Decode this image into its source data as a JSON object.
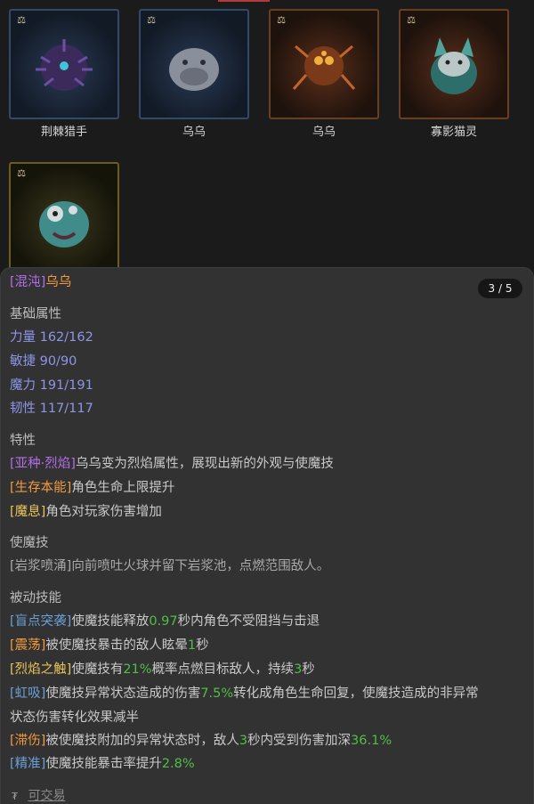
{
  "cards": [
    {
      "name": "荆棘猎手",
      "frame": "blue",
      "icon": "thorny-beast-icon"
    },
    {
      "name": "乌乌",
      "frame": "blue",
      "icon": "pale-beast-icon"
    },
    {
      "name": "乌乌",
      "frame": "orange",
      "icon": "fire-spider-icon"
    },
    {
      "name": "寡影猫灵",
      "frame": "orange",
      "icon": "ghost-cat-icon"
    },
    {
      "name": "",
      "frame": "gold",
      "icon": "teal-beast-icon"
    }
  ],
  "rank_glyph": "⚖",
  "detail": {
    "title_prefix": "[混沌]",
    "title_name": "乌乌",
    "pager": "3 / 5",
    "base_heading": "基础属性",
    "stats": [
      "力量 162/162",
      "敏捷 90/90",
      "魔力 191/191",
      "韧性 117/117"
    ],
    "traits_heading": "特性",
    "traits": [
      {
        "tag": "[亚种·烈焰]",
        "text": "乌乌变为烈焰属性，展现出新的外观与使魔技"
      },
      {
        "tag": "[生存本能]",
        "text": "角色生命上限提升"
      },
      {
        "tag": "[魔息]",
        "text": "角色对玩家伤害增加"
      }
    ],
    "skill_heading": "使魔技",
    "skill_text": "[岩浆喷涌]向前喷吐火球并留下岩浆池，点燃范围敌人。",
    "passive_heading": "被动技能",
    "passives": {
      "p1_tag": "[盲点突袭]",
      "p1_a": "使魔技能释放",
      "p1_v": "0.97",
      "p1_b": "秒内角色不受阻挡与击退",
      "p2_tag": "[震荡]",
      "p2_a": "被使魔技暴击的敌人眩晕",
      "p2_v": "1",
      "p2_b": "秒",
      "p3_tag": "[烈焰之触]",
      "p3_a": "使魔技有",
      "p3_v1": "21%",
      "p3_b": "概率点燃目标敌人，持续",
      "p3_v2": "3",
      "p3_c": "秒",
      "p4_tag": "[虹吸]",
      "p4_a": "使魔技异常状态造成的伤害",
      "p4_v": "7.5%",
      "p4_b": "转化成角色生命回复，使魔技造成的非异常",
      "p4_c": "状态伤害转化效果减半",
      "p5_tag": "[滞伤]",
      "p5_a": "被使魔技附加的异常状态时，敌人",
      "p5_v1": "3",
      "p5_b": "秒内受到伤害加深",
      "p5_v2": "36.1%",
      "p6_tag": "[精准]",
      "p6_a": "使魔技能暴击率提升",
      "p6_v": "2.8%"
    },
    "tradable_label": "可交易",
    "tradable_icon": "₮"
  },
  "colors": {
    "purple": "#b46ee8",
    "orange": "#f29a3d",
    "yellow": "#e9c55a",
    "blue": "#6aa0d6",
    "green": "#4fbf45",
    "stat": "#8e95e8"
  }
}
